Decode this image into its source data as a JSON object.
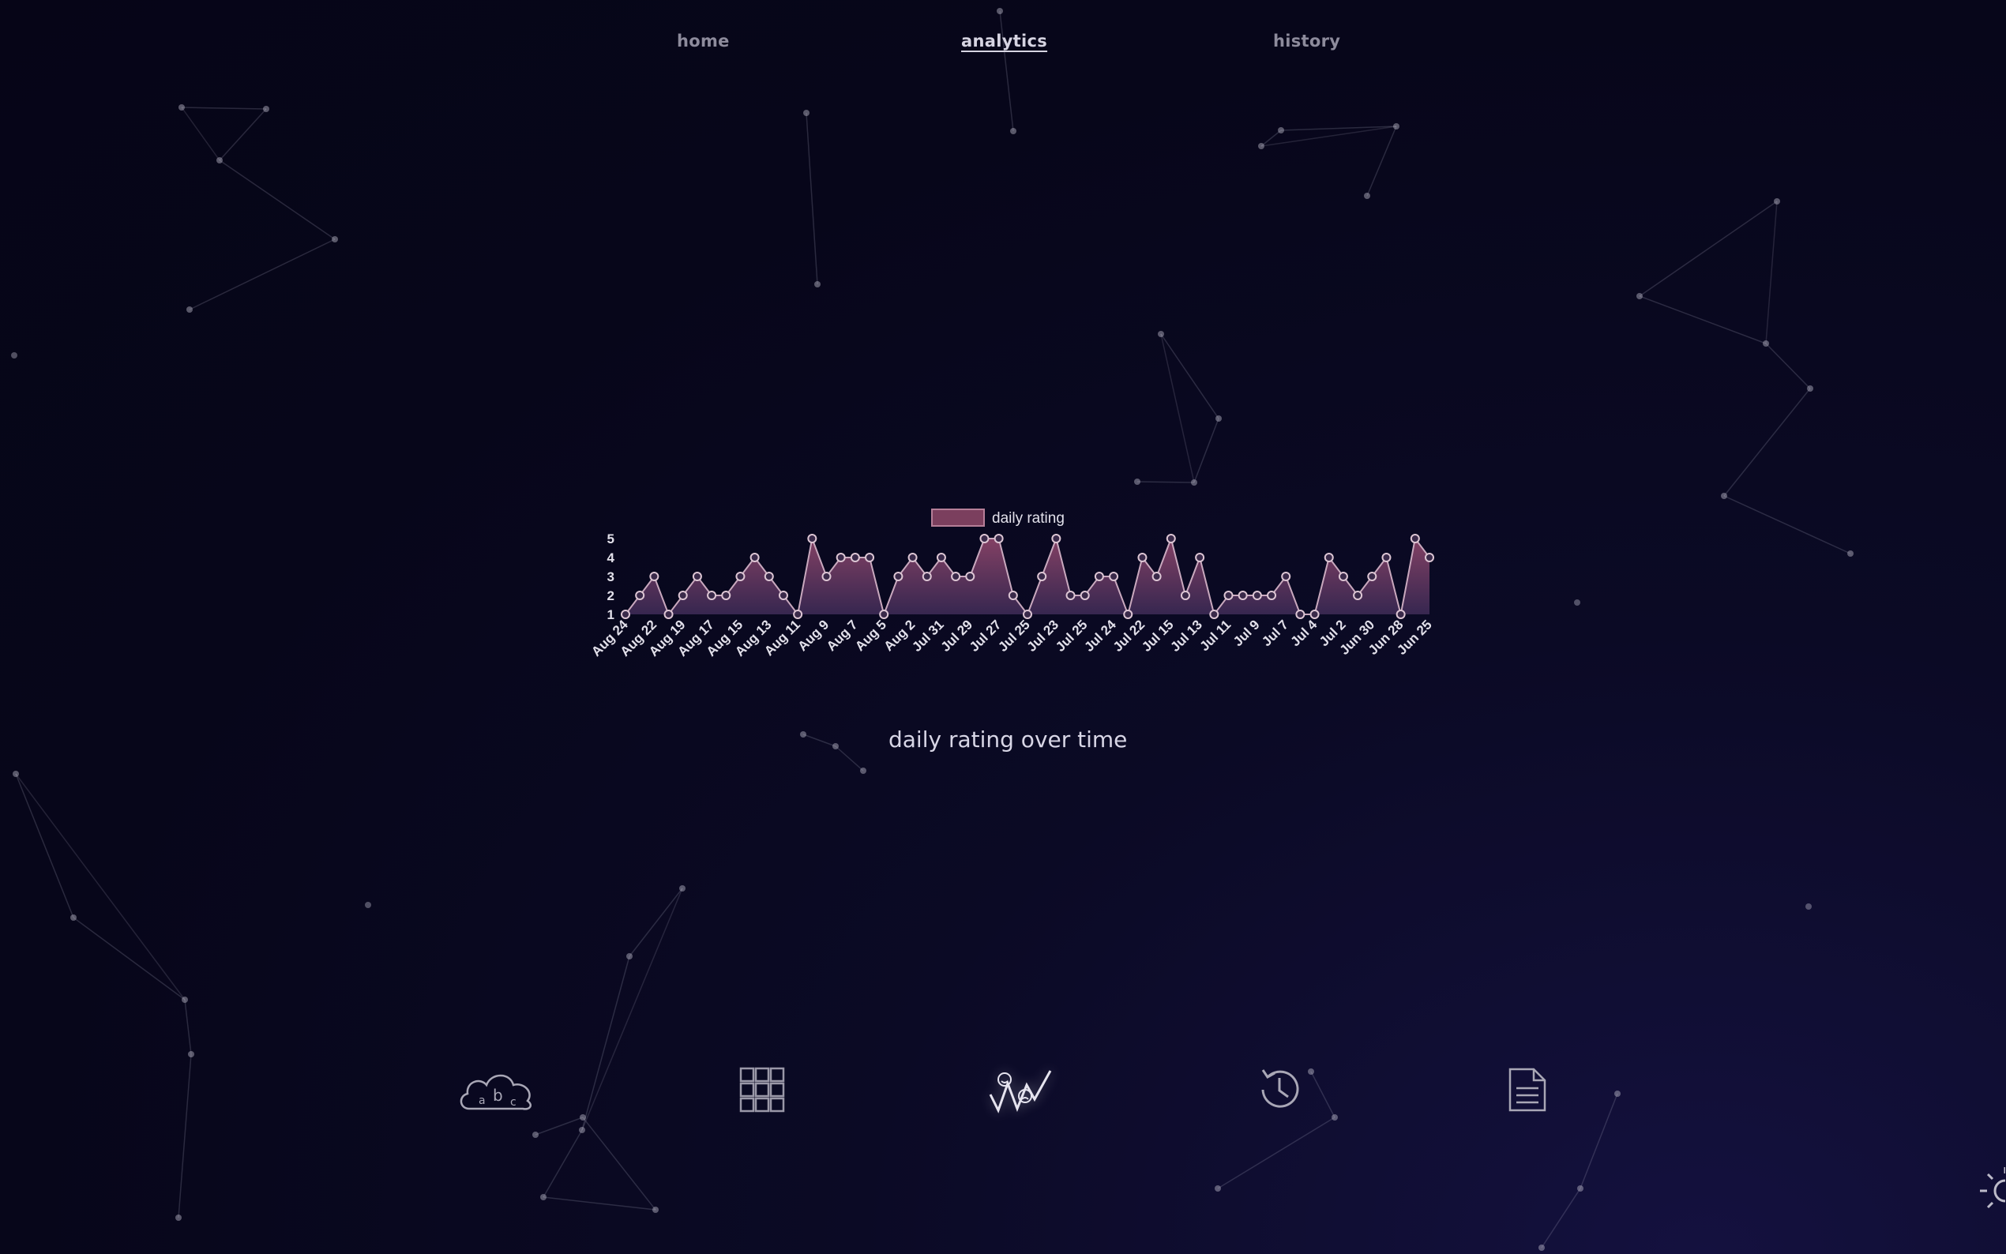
{
  "nav": {
    "home": "home",
    "analytics": "analytics",
    "history": "history"
  },
  "colors": {
    "accent_fill": "#7b3f5e",
    "line": "#c9a9be",
    "text": "#d8d6e6",
    "muted": "#8d8b9c",
    "background": "#07061a"
  },
  "chart_data": {
    "type": "area",
    "legend": [
      "daily rating"
    ],
    "legend_position": "top-center",
    "series": [
      {
        "name": "daily rating",
        "values": [
          1,
          2,
          3,
          1,
          2,
          3,
          2,
          2,
          3,
          4,
          3,
          2,
          1,
          5,
          3,
          4,
          4,
          4,
          1,
          3,
          4,
          3,
          4,
          3,
          3,
          5,
          5,
          2,
          1,
          3,
          5,
          2,
          2,
          3,
          3,
          1,
          4,
          3,
          5,
          2,
          4,
          1,
          2,
          2,
          2,
          2,
          3,
          1,
          1,
          4,
          3,
          2,
          3,
          4,
          1,
          5,
          4
        ]
      }
    ],
    "tick_labels": [
      "Aug 24",
      "Aug 22",
      "Aug 19",
      "Aug 17",
      "Aug 15",
      "Aug 13",
      "Aug 11",
      "Aug 9",
      "Aug 7",
      "Aug 5",
      "Aug 2",
      "Jul 31",
      "Jul 29",
      "Jul 27",
      "Jul 25",
      "Jul 23",
      "Jul 25",
      "Jul 24",
      "Jul 22",
      "Jul 15",
      "Jul 13",
      "Jul 11",
      "Jul 9",
      "Jul 7",
      "Jul 4",
      "Jul 2",
      "Jun 30",
      "Jun 28",
      "Jun 25"
    ],
    "y_ticks": [
      1,
      2,
      3,
      4,
      5
    ],
    "ylim": [
      1,
      5
    ],
    "caption": "daily rating over time"
  },
  "toolbar": {
    "items": [
      {
        "icon": "word-cloud-icon",
        "cloud_letters": [
          "a",
          "b",
          "c"
        ]
      },
      {
        "icon": "grid-icon"
      },
      {
        "icon": "mood-chart-icon"
      },
      {
        "icon": "history-icon"
      },
      {
        "icon": "document-icon"
      }
    ]
  },
  "theme_toggle": {
    "icon": "sun-icon"
  }
}
